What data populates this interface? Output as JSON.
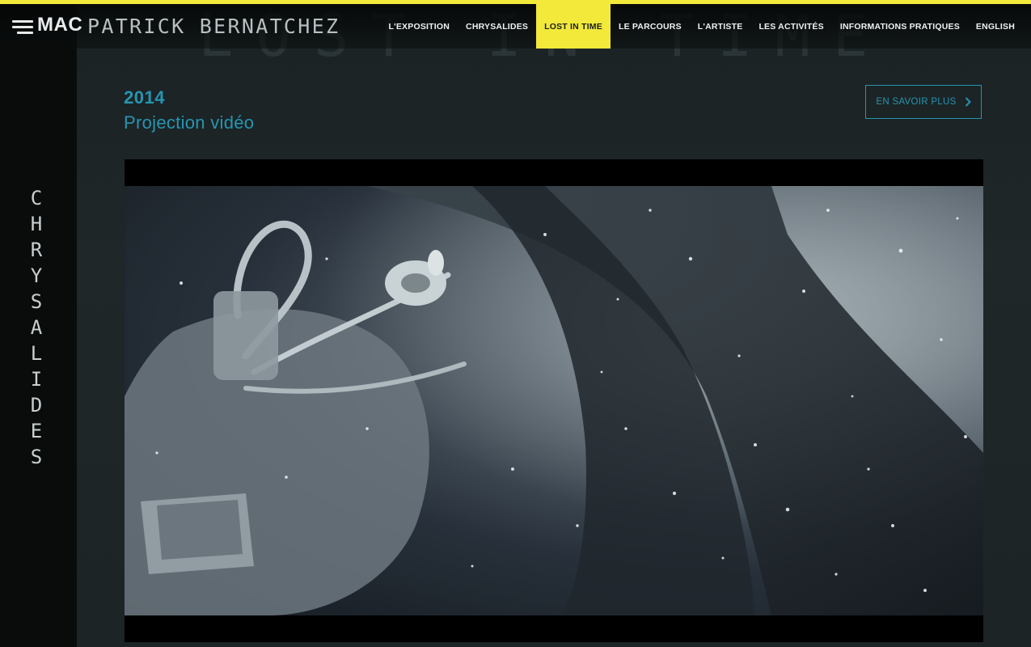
{
  "header": {
    "logo": "MAC",
    "artist": "PATRICK BERNATCHEZ",
    "nav": [
      {
        "label": "L'EXPOSITION",
        "active": false
      },
      {
        "label": "CHRYSALIDES",
        "active": false
      },
      {
        "label": "LOST IN TIME",
        "active": true
      },
      {
        "label": "LE PARCOURS",
        "active": false
      },
      {
        "label": "L'ARTISTE",
        "active": false
      },
      {
        "label": "LES ACTIVITÉS",
        "active": false
      },
      {
        "label": "INFORMATIONS PRATIQUES",
        "active": false
      },
      {
        "label": "ENGLISH",
        "active": false
      }
    ]
  },
  "sidebar": {
    "letters": [
      "C",
      "H",
      "R",
      "Y",
      "S",
      "A",
      "L",
      "I",
      "D",
      "E",
      "S"
    ]
  },
  "content": {
    "ghost_title": "LOST IN TIME",
    "year": "2014",
    "subtitle": "Projection vidéo",
    "more_button": "EN SAVOIR PLUS"
  },
  "colors": {
    "accent_yellow": "#f2e93a",
    "accent_teal": "#2795b0",
    "sidebar_bg": "#0a0c0c"
  },
  "icons": {
    "menu": "hamburger-icon",
    "more": "chevron-right-icon"
  }
}
